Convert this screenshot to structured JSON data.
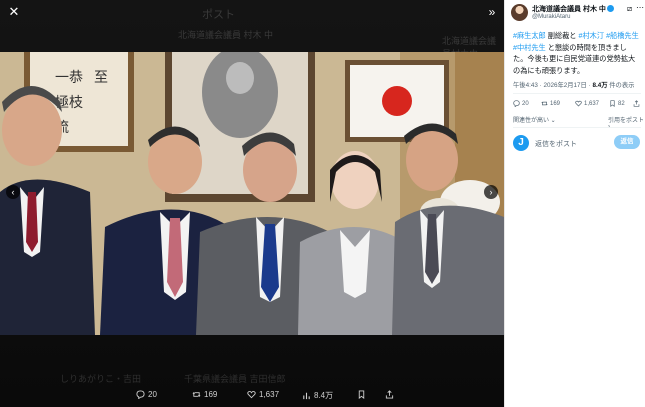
{
  "viewer": {
    "ghost_header_title": "ポスト",
    "ghost_row": "北海道議会議員 村木 中",
    "ghost_follow": "北海道議会議員村木中",
    "ghost_bottom_left": "しりあがりこ・吉田",
    "ghost_bottom_mid": "千葉県議会議員 吉田信郎",
    "close_icon": "close-icon",
    "expand_icon": "expand-icon",
    "actions": {
      "replies": "20",
      "reposts": "169",
      "likes": "1,637",
      "views": "8.4万"
    }
  },
  "post": {
    "author_name": "北海道議会議員 村木 中",
    "handle": "@MurakiAtaru",
    "text_parts": {
      "tag1": "#麻生太郎",
      "t1": " 副総裁と ",
      "tag2": "#村木汀",
      "t2": " ",
      "tag3": "#船橋先生",
      "t3": " ",
      "tag4": "#中村先生",
      "t4": " と懇談の時間を頂きました。今後も更に自民党道連の党勢拡大の為にも頑張ります。"
    },
    "timestamp": "午後4:43 · 2026年2月17日 · ",
    "views_count": "8.4万",
    "views_label": " 件の表示",
    "stats": {
      "replies": "20",
      "reposts": "169",
      "likes": "1,637",
      "bookmarks": "82"
    },
    "related_label": "関連性が高い ⌄",
    "quote_label": "引用をポスト ›",
    "reply_placeholder": "返信をポスト",
    "reply_button": "返信"
  },
  "colors": {
    "accent": "#1d9bf0",
    "reply_button_disabled": "#8ecdf7",
    "japan_flag_red": "#d7261e"
  }
}
